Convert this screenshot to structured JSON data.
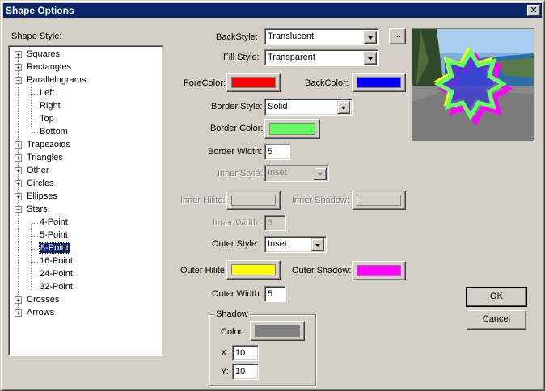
{
  "window": {
    "title": "Shape Options",
    "close_glyph": "✕"
  },
  "tree": {
    "label": "Shape Style:",
    "items": [
      {
        "label": "Squares",
        "expander": "+"
      },
      {
        "label": "Rectangles",
        "expander": "+"
      },
      {
        "label": "Parallelograms",
        "expander": "−"
      },
      {
        "label": "Left"
      },
      {
        "label": "Right"
      },
      {
        "label": "Top"
      },
      {
        "label": "Bottom"
      },
      {
        "label": "Trapezoids",
        "expander": "+"
      },
      {
        "label": "Triangles",
        "expander": "+"
      },
      {
        "label": "Other",
        "expander": "+"
      },
      {
        "label": "Circles",
        "expander": "+"
      },
      {
        "label": "Ellipses",
        "expander": "+"
      },
      {
        "label": "Stars",
        "expander": "−"
      },
      {
        "label": "4-Point"
      },
      {
        "label": "5-Point"
      },
      {
        "label": "8-Point",
        "selected": true
      },
      {
        "label": "16-Point"
      },
      {
        "label": "24-Point"
      },
      {
        "label": "32-Point"
      },
      {
        "label": "Crosses",
        "expander": "+"
      },
      {
        "label": "Arrows",
        "expander": "+"
      }
    ]
  },
  "form": {
    "back_style": {
      "label": "BackStyle:",
      "value": "Translucent",
      "browse": "..."
    },
    "fill_style": {
      "label": "Fill Style:",
      "value": "Transparent"
    },
    "fore_color": {
      "label": "ForeColor:",
      "color": "#ff0000"
    },
    "back_color": {
      "label": "BackColor:",
      "color": "#0000ff"
    },
    "border_style": {
      "label": "Border Style:",
      "value": "Solid"
    },
    "border_color": {
      "label": "Border Color:",
      "color": "#66ff66"
    },
    "border_width": {
      "label": "Border Width:",
      "value": "5"
    },
    "inner_style": {
      "label": "Inner Style:",
      "value": "Inset"
    },
    "inner_hilite": {
      "label": "Inner Hilite:",
      "color": "#d4d0c8"
    },
    "inner_shadow": {
      "label": "Inner Shadow:",
      "color": "#d4d0c8"
    },
    "inner_width": {
      "label": "Inner Width:",
      "value": "3"
    },
    "outer_style": {
      "label": "Outer Style:",
      "value": "Inset"
    },
    "outer_hilite": {
      "label": "Outer Hilite:",
      "color": "#ffff00"
    },
    "outer_shadow": {
      "label": "Outer Shadow:",
      "color": "#ff00ff"
    },
    "outer_width": {
      "label": "Outer Width:",
      "value": "5"
    },
    "shadow": {
      "title": "Shadow",
      "color_label": "Color:",
      "color": "#808080",
      "x_label": "X:",
      "x_value": "10",
      "y_label": "Y:",
      "y_value": "10"
    }
  },
  "buttons": {
    "ok": "OK",
    "cancel": "Cancel"
  },
  "preview": {
    "star_fill": "#3b3bd6",
    "border_color": "#66ff66",
    "hilite": "#ffff00",
    "shadow": "#ff00ff"
  }
}
